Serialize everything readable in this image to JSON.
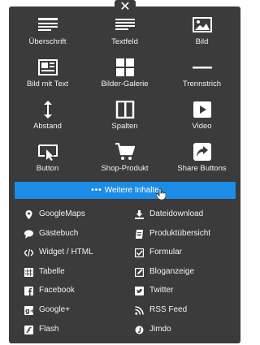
{
  "close_symbol": "✕",
  "tiles": [
    {
      "label": "Überschrift",
      "icon": "heading-icon"
    },
    {
      "label": "Textfeld",
      "icon": "text-field-icon"
    },
    {
      "label": "Bild",
      "icon": "image-icon"
    },
    {
      "label": "Bild mit Text",
      "icon": "image-with-text-icon"
    },
    {
      "label": "Bilder-Galerie",
      "icon": "gallery-icon"
    },
    {
      "label": "Trennstrich",
      "icon": "divider-icon"
    },
    {
      "label": "Abstand",
      "icon": "spacing-icon"
    },
    {
      "label": "Spalten",
      "icon": "columns-icon"
    },
    {
      "label": "Video",
      "icon": "video-icon"
    },
    {
      "label": "Button",
      "icon": "button-icon"
    },
    {
      "label": "Shop-Produkt",
      "icon": "shopping-cart-icon"
    },
    {
      "label": "Share Buttons",
      "icon": "share-icon"
    }
  ],
  "more_button": {
    "dots": "•••",
    "label": "Weitere Inhalte"
  },
  "left_list": [
    {
      "label": "GoogleMaps",
      "icon": "map-pin-icon"
    },
    {
      "label": "Gästebuch",
      "icon": "speech-bubble-icon"
    },
    {
      "label": "Widget / HTML",
      "icon": "code-icon"
    },
    {
      "label": "Tabelle",
      "icon": "table-icon"
    },
    {
      "label": "Facebook",
      "icon": "facebook-icon"
    },
    {
      "label": "Google+",
      "icon": "google-plus-icon"
    },
    {
      "label": "Flash",
      "icon": "flash-icon"
    }
  ],
  "right_list": [
    {
      "label": "Dateidownload",
      "icon": "download-icon"
    },
    {
      "label": "Produktübersicht",
      "icon": "catalog-icon"
    },
    {
      "label": "Formular",
      "icon": "form-icon"
    },
    {
      "label": "Bloganzeige",
      "icon": "blog-icon"
    },
    {
      "label": "Twitter",
      "icon": "twitter-icon"
    },
    {
      "label": "RSS Feed",
      "icon": "rss-icon"
    },
    {
      "label": "Jimdo",
      "icon": "jimdo-icon"
    }
  ]
}
